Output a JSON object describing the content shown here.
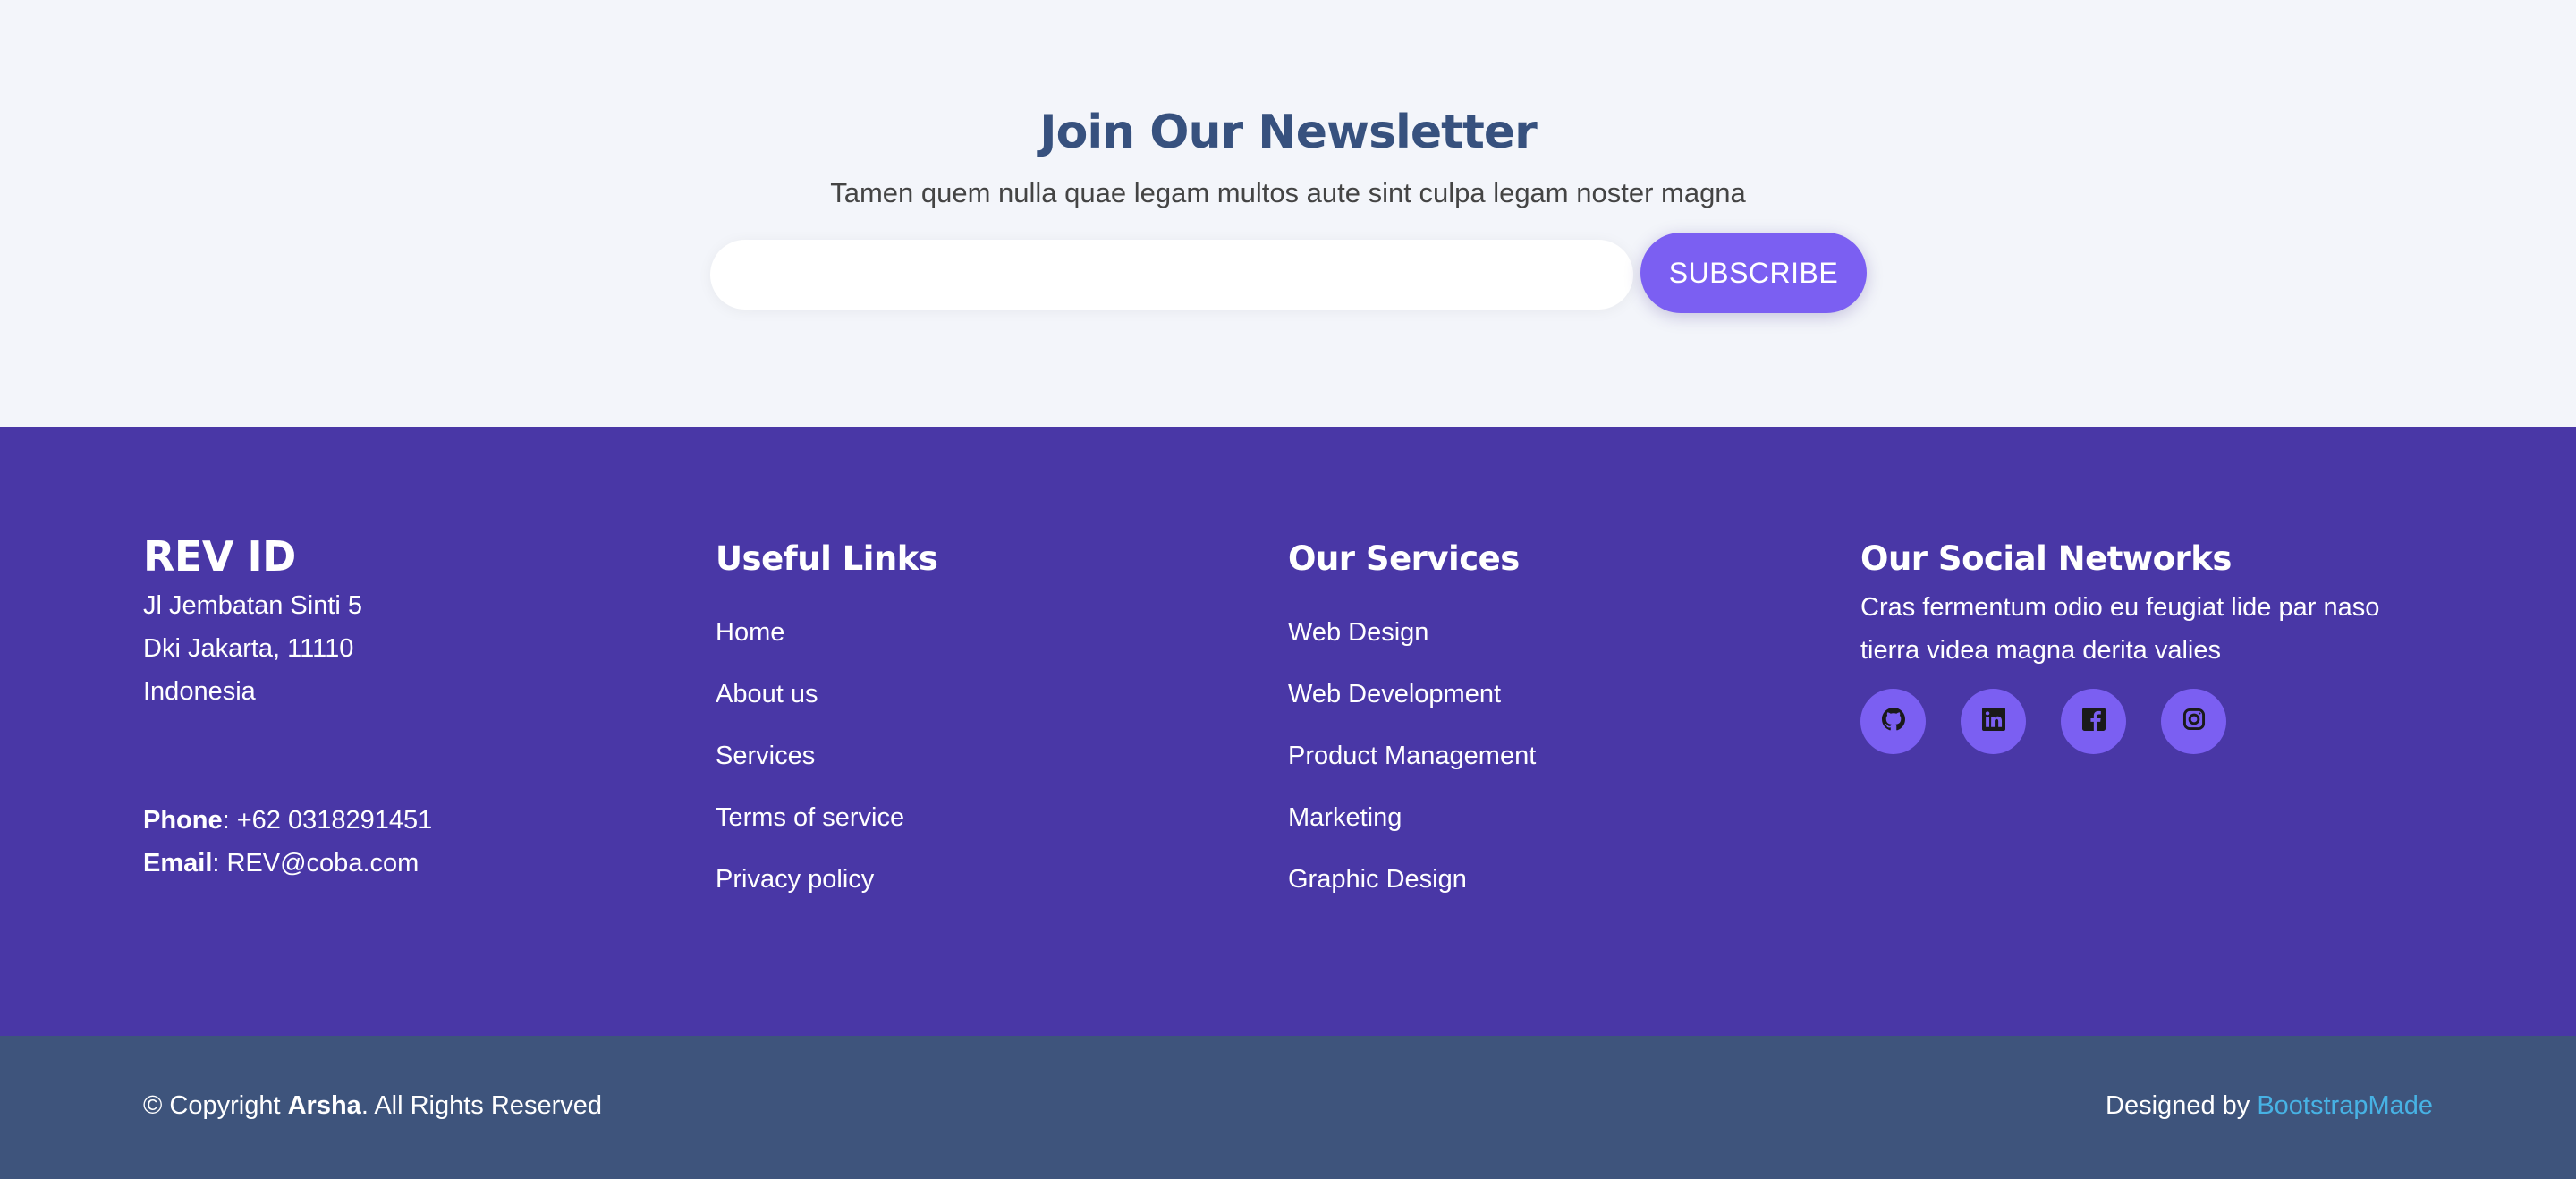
{
  "newsletter": {
    "title": "Join Our Newsletter",
    "subtitle": "Tamen quem nulla quae legam multos aute sint culpa legam noster magna",
    "email_value": "",
    "email_placeholder": "",
    "subscribe_label": "SUBSCRIBE"
  },
  "contact": {
    "brand": "REV ID",
    "address_lines": [
      "Jl Jembatan Sinti 5",
      "Dki Jakarta, 11110",
      "Indonesia"
    ],
    "phone_label": "Phone",
    "phone_value": ": +62 0318291451",
    "email_label": "Email",
    "email_value": ": REV@coba.com"
  },
  "useful_links": {
    "heading": "Useful Links",
    "items": [
      "Home",
      "About us",
      "Services",
      "Terms of service",
      "Privacy policy"
    ]
  },
  "services": {
    "heading": "Our Services",
    "items": [
      "Web Design",
      "Web Development",
      "Product Management",
      "Marketing",
      "Graphic Design"
    ]
  },
  "social": {
    "heading": "Our Social Networks",
    "text": "Cras fermentum odio eu feugiat lide par naso tierra videa magna derita valies",
    "icons": [
      "github-icon",
      "linkedin-icon",
      "facebook-icon",
      "instagram-icon"
    ]
  },
  "footer": {
    "copyright_prefix": "© Copyright ",
    "copyright_brand": "Arsha",
    "copyright_suffix": ". All Rights Reserved",
    "credits_prefix": "Designed by ",
    "credits_link": "BootstrapMade"
  },
  "colors": {
    "newsletter_bg": "#f3f5fa",
    "footer_bg": "#4937a6",
    "footer_bottom_bg": "#3e547c",
    "accent": "#7b5ff2",
    "title": "#37517e",
    "credit_link": "#47b2e4"
  }
}
